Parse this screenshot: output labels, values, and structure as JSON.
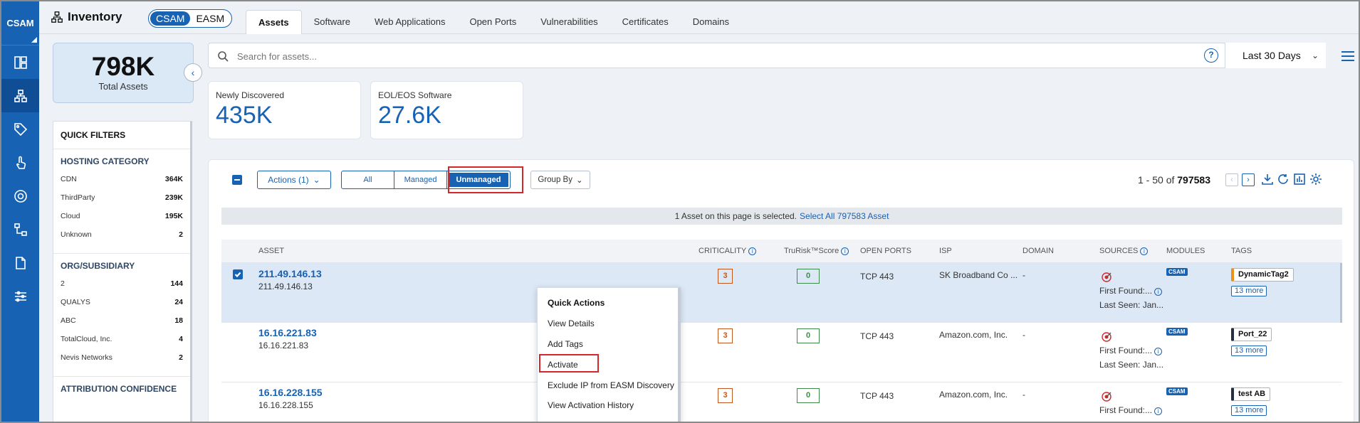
{
  "rail": {
    "brand": "CSAM"
  },
  "header": {
    "title": "Inventory",
    "modes": [
      "CSAM",
      "EASM"
    ],
    "tabs": [
      "Assets",
      "Software",
      "Web Applications",
      "Open Ports",
      "Vulnerabilities",
      "Certificates",
      "Domains"
    ]
  },
  "summary": {
    "value": "798K",
    "label": "Total Assets"
  },
  "search": {
    "placeholder": "Search for assets...",
    "help": "?",
    "period": "Last 30 Days"
  },
  "cards": [
    {
      "title": "Newly Discovered",
      "value": "435K"
    },
    {
      "title": "EOL/EOS Software",
      "value": "27.6K"
    }
  ],
  "filters": {
    "title": "QUICK FILTERS",
    "sections": [
      {
        "title": "HOSTING CATEGORY",
        "rows": [
          {
            "label": "CDN",
            "count": "364K"
          },
          {
            "label": "ThirdParty",
            "count": "239K"
          },
          {
            "label": "Cloud",
            "count": "195K"
          },
          {
            "label": "Unknown",
            "count": "2"
          }
        ]
      },
      {
        "title": "ORG/SUBSIDIARY",
        "rows": [
          {
            "label": "2",
            "count": "144"
          },
          {
            "label": "QUALYS",
            "count": "24"
          },
          {
            "label": "ABC",
            "count": "18"
          },
          {
            "label": "TotalCloud, Inc.",
            "count": "4"
          },
          {
            "label": "Nevis Networks",
            "count": "2"
          }
        ]
      },
      {
        "title": "ATTRIBUTION CONFIDENCE",
        "rows": []
      }
    ]
  },
  "toolbar": {
    "actions": "Actions (1)",
    "seg": [
      "All",
      "Managed",
      "Unmanaged"
    ],
    "groupby": "Group By",
    "pager_range": "1 - 50 of",
    "pager_total": "797583"
  },
  "selection": {
    "text": "1 Asset on this page is selected.",
    "link": "Select All 797583 Asset"
  },
  "columns": [
    "ASSET",
    "CRITICALITY",
    "TruRisk™Score",
    "OPEN PORTS",
    "ISP",
    "DOMAIN",
    "SOURCES",
    "MODULES",
    "TAGS"
  ],
  "rows": [
    {
      "name": "211.49.146.13",
      "ip": "211.49.146.13",
      "crit": "3",
      "score": "0",
      "ports": "TCP 443",
      "isp": "SK Broadband Co ...",
      "domain": "-",
      "first": "First Found:...",
      "last": "Last Seen: Jan...",
      "module": "CSAM",
      "tag": "DynamicTag2",
      "more": "13 more"
    },
    {
      "name": "16.16.221.83",
      "ip": "16.16.221.83",
      "crit": "3",
      "score": "0",
      "ports": "TCP 443",
      "isp": "Amazon.com, Inc.",
      "domain": "-",
      "first": "First Found:...",
      "last": "Last Seen: Jan...",
      "module": "CSAM",
      "tag": "Port_22",
      "more": "13 more"
    },
    {
      "name": "16.16.228.155",
      "ip": "16.16.228.155",
      "crit": "3",
      "score": "0",
      "ports": "TCP 443",
      "isp": "Amazon.com, Inc.",
      "domain": "-",
      "first": "First Found:...",
      "last": "",
      "module": "CSAM",
      "tag": "test AB",
      "more": "13 more"
    }
  ],
  "quick_actions": {
    "title": "Quick Actions",
    "items": [
      "View Details",
      "Add Tags",
      "Activate",
      "Exclude IP from EASM Discovery",
      "View Activation History"
    ]
  },
  "colors": {
    "primary": "#1862b4",
    "highlight": "#d3272c",
    "critical": "#c0581f",
    "score": "#3f8a4d"
  }
}
